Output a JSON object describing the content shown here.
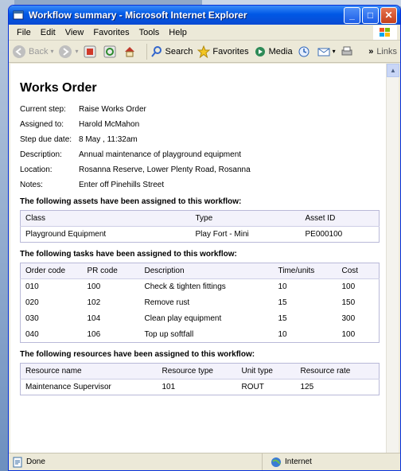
{
  "window": {
    "title": "Workflow summary - Microsoft Internet Explorer"
  },
  "menu": [
    "File",
    "Edit",
    "View",
    "Favorites",
    "Tools",
    "Help"
  ],
  "toolbar": {
    "back": "Back",
    "search": "Search",
    "favorites": "Favorites",
    "media": "Media",
    "links": "Links",
    "more": "»"
  },
  "page": {
    "heading": "Works Order",
    "fields": [
      {
        "label": "Current step:",
        "value": "Raise Works Order"
      },
      {
        "label": "Assigned to:",
        "value": "Harold McMahon"
      },
      {
        "label": "Step due date:",
        "value": "8 May , 11:32am"
      },
      {
        "label": "Description:",
        "value": "Annual maintenance of playground equipment"
      },
      {
        "label": "Location:",
        "value": "Rosanna Reserve, Lower Plenty Road, Rosanna"
      },
      {
        "label": "Notes:",
        "value": "Enter off Pinehills Street"
      }
    ],
    "assets": {
      "title": "The following assets have been assigned to this workflow:",
      "headers": [
        "Class",
        "Type",
        "Asset ID"
      ],
      "rows": [
        [
          "Playground Equipment",
          "Play Fort - Mini",
          "PE000100"
        ]
      ]
    },
    "tasks": {
      "title": "The following tasks have been assigned to this workflow:",
      "headers": [
        "Order code",
        "PR code",
        "Description",
        "Time/units",
        "Cost"
      ],
      "rows": [
        [
          "010",
          "100",
          "Check & tighten fittings",
          "10",
          "100"
        ],
        [
          "020",
          "102",
          "Remove rust",
          "15",
          "150"
        ],
        [
          "030",
          "104",
          "Clean play equipment",
          "15",
          "300"
        ],
        [
          "040",
          "106",
          "Top up softfall",
          "10",
          "100"
        ]
      ]
    },
    "resources": {
      "title": "The following resources have been assigned to this workflow:",
      "headers": [
        "Resource name",
        "Resource type",
        "Unit type",
        "Resource rate"
      ],
      "rows": [
        [
          "Maintenance Supervisor",
          "101",
          "ROUT",
          "125"
        ]
      ]
    }
  },
  "status": {
    "left": "Done",
    "zone": "Internet"
  }
}
